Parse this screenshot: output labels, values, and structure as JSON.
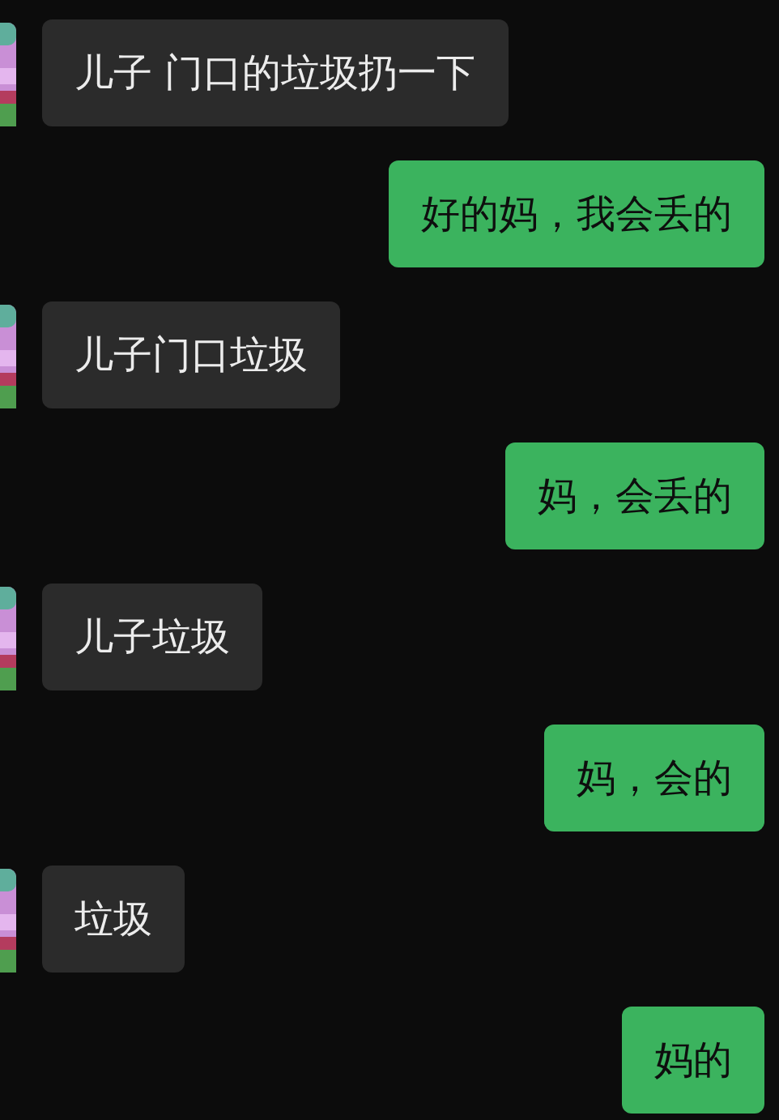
{
  "messages": [
    {
      "kind": "received",
      "text": "儿子 门口的垃圾扔一下"
    },
    {
      "kind": "sent",
      "text": "好的妈，我会丢的"
    },
    {
      "kind": "received",
      "text": "儿子门口垃圾"
    },
    {
      "kind": "sent",
      "text": "妈，会丢的"
    },
    {
      "kind": "received",
      "text": "儿子垃圾"
    },
    {
      "kind": "sent",
      "text": "妈，会的"
    },
    {
      "kind": "received",
      "text": "垃圾"
    },
    {
      "kind": "sent",
      "text": "妈的"
    }
  ]
}
